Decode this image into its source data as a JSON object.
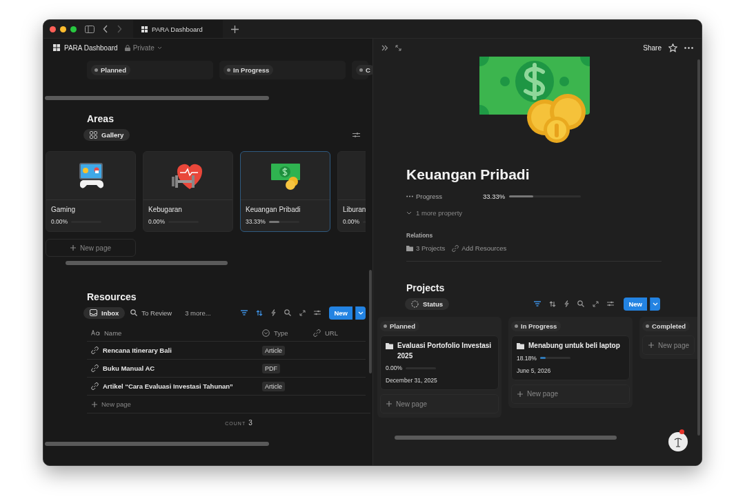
{
  "browser_tab": {
    "title": "PARA Dashboard"
  },
  "left": {
    "breadcrumb": {
      "title": "PARA Dashboard",
      "privacy": "Private"
    },
    "top_board_groups": [
      {
        "label": "Planned"
      },
      {
        "label": "In Progress"
      },
      {
        "label": "C"
      }
    ],
    "areas": {
      "title": "Areas",
      "views": [
        {
          "label": "Gallery",
          "selected": true
        }
      ],
      "cards": [
        {
          "title": "Gaming",
          "progress": "0.00%",
          "level": 0,
          "selected": false,
          "kind": "gaming"
        },
        {
          "title": "Kebugaran",
          "progress": "0.00%",
          "level": 0,
          "selected": false,
          "kind": "fitness"
        },
        {
          "title": "Keuangan Pribadi",
          "progress": "33.33%",
          "level": 0.3333,
          "selected": true,
          "kind": "money"
        },
        {
          "title": "Liburan",
          "progress": "0.00%",
          "level": 0,
          "selected": false,
          "kind": "blank"
        }
      ],
      "new_page": "New page"
    },
    "resources": {
      "title": "Resources",
      "views": [
        {
          "label": "Inbox",
          "selected": true,
          "kind": "inbox"
        },
        {
          "label": "To Review",
          "selected": false,
          "kind": "search"
        }
      ],
      "more_views": "3 more...",
      "new_button": "New",
      "columns": [
        {
          "label": "Name",
          "kind": "text"
        },
        {
          "label": "Type",
          "kind": "select"
        },
        {
          "label": "URL",
          "kind": "url"
        }
      ],
      "rows": [
        {
          "name": "Rencana Itinerary Bali",
          "type": "Article"
        },
        {
          "name": "Buku Manual AC",
          "type": "PDF"
        },
        {
          "name": "Artikel “Cara Evaluasi Investasi Tahunan”",
          "type": "Article"
        }
      ],
      "new_page": "New page",
      "count_label": "COUNT",
      "count": "3"
    }
  },
  "right": {
    "share": "Share",
    "page": {
      "title": "Keuangan Pribadi",
      "properties": [
        {
          "name": "Progress",
          "value": "33.33%",
          "level": 0.3333
        }
      ],
      "more_properties": "1 more property",
      "relations_heading": "Relations",
      "relations": [
        {
          "label": "3 Projects",
          "kind": "folder"
        },
        {
          "label": "Add Resources",
          "kind": "link"
        }
      ]
    },
    "projects": {
      "title": "Projects",
      "views": [
        {
          "label": "Status",
          "selected": true
        }
      ],
      "new_button": "New",
      "groups": [
        {
          "label": "Planned",
          "cards": [
            {
              "title": "Evaluasi Portofolio Investasi 2025",
              "progress": "0.00%",
              "level": 0,
              "date": "December 31, 2025"
            }
          ],
          "new_page": "New page"
        },
        {
          "label": "In Progress",
          "cards": [
            {
              "title": "Menabung untuk beli laptop",
              "progress": "18.18%",
              "level": 0.1818,
              "date": "June 5, 2026"
            }
          ],
          "new_page": "New page"
        },
        {
          "label": "Completed",
          "new_page": "New page"
        }
      ]
    }
  }
}
